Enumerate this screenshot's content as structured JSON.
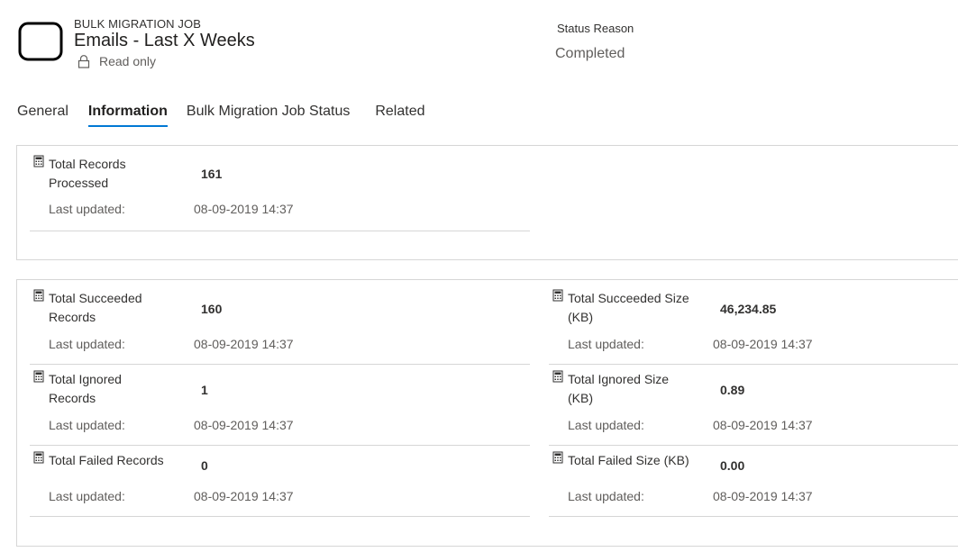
{
  "header": {
    "entity_type": "BULK MIGRATION JOB",
    "record_title": "Emails - Last X Weeks",
    "readonly_text": "Read only",
    "status_label": "Status Reason",
    "status_value": "Completed"
  },
  "tabs": [
    {
      "label": "General"
    },
    {
      "label": "Information"
    },
    {
      "label": "Bulk Migration Job Status"
    },
    {
      "label": "Related"
    }
  ],
  "updated_label": "Last updated:",
  "section1": {
    "total_records_processed": {
      "label": "Total Records Processed",
      "value": "161",
      "updated": "08-09-2019 14:37"
    }
  },
  "section2": {
    "total_succeeded_records": {
      "label": "Total Succeeded Records",
      "value": "160",
      "updated": "08-09-2019 14:37"
    },
    "total_succeeded_size": {
      "label": "Total Succeeded Size (KB)",
      "value": "46,234.85",
      "updated": "08-09-2019 14:37"
    },
    "total_ignored_records": {
      "label": "Total Ignored Records",
      "value": "1",
      "updated": "08-09-2019 14:37"
    },
    "total_ignored_size": {
      "label": "Total Ignored Size (KB)",
      "value": "0.89",
      "updated": "08-09-2019 14:37"
    },
    "total_failed_records": {
      "label": "Total Failed Records",
      "value": "0",
      "updated": "08-09-2019 14:37"
    },
    "total_failed_size": {
      "label": "Total Failed Size (KB)",
      "value": "0.00",
      "updated": "08-09-2019 14:37"
    }
  },
  "icons": {
    "entity": "entity-record-icon",
    "readonly": "lock-icon",
    "field": "calculated-field-icon"
  },
  "colors": {
    "tab_underline": "#0078d4"
  }
}
